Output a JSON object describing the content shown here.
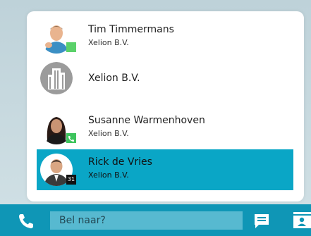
{
  "contacts": [
    {
      "name": "Tim Timmermans",
      "company": "Xelion B.V.",
      "presence": "available",
      "presence_color": "#5bd16a"
    },
    {
      "name": "Xelion B.V.",
      "company": "",
      "type": "organization"
    },
    {
      "name": "Susanne Warmenhoven",
      "company": "Xelion B.V.",
      "presence": "on-call",
      "presence_color": "#3dc45d"
    },
    {
      "name": "Rick de Vries",
      "company": "Xelion B.V.",
      "presence": "in-meeting",
      "presence_badge": "31",
      "selected": true
    }
  ],
  "bottombar": {
    "search_placeholder": "Bel naar?",
    "accent_color": "#0f96b6"
  },
  "selection_color": "#0aa6c6"
}
